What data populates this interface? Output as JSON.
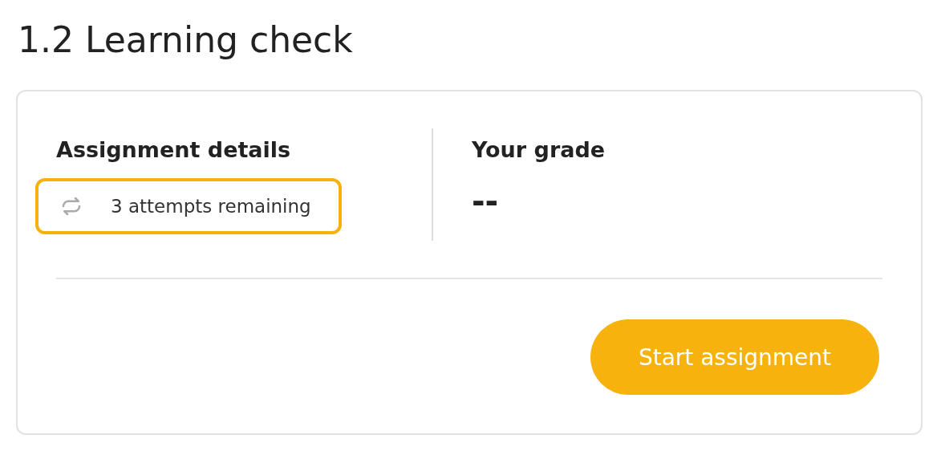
{
  "title": "1.2 Learning check",
  "details": {
    "heading": "Assignment details",
    "attempts": "3 attempts remaining",
    "highlighted": true
  },
  "grade": {
    "heading": "Your grade",
    "value": "--"
  },
  "button": {
    "label": "Start assignment"
  }
}
